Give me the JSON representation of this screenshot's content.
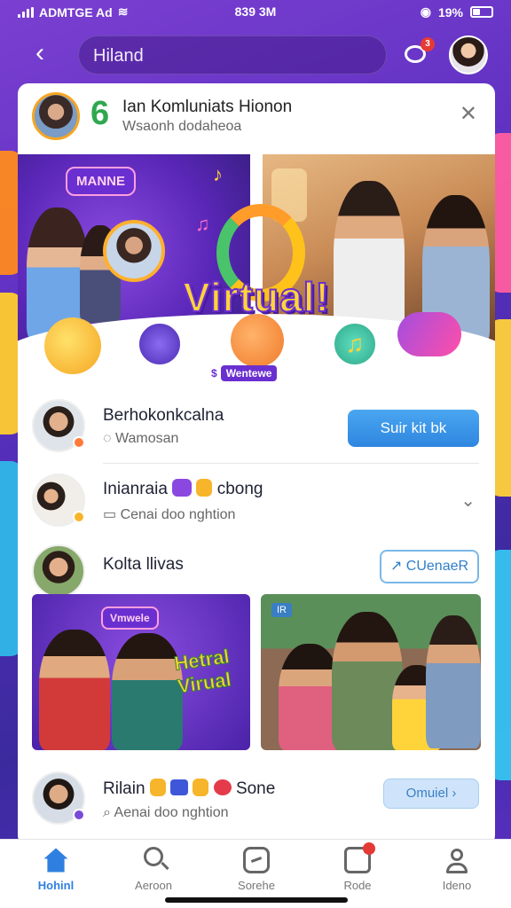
{
  "status_bar": {
    "carrier": "ADMTGE Ad",
    "time": "839 3M",
    "battery": "19%",
    "icons": [
      "signal-icon",
      "wifi-icon",
      "location-icon",
      "battery-icon"
    ]
  },
  "header": {
    "search_value": "Hiland",
    "notification_count": "3",
    "icons": [
      "back-icon",
      "chat-bubble-icon",
      "profile-avatar"
    ]
  },
  "group": {
    "title": "Ian Komluniats Hionon",
    "subtitle": "Wsaonh dodaheoa",
    "logo_glyph": "6"
  },
  "hero": {
    "speech_badge": "MANNE",
    "title": "Virtual!",
    "tag_text": "$",
    "tag_pill": "Wentewe"
  },
  "rows": [
    {
      "name": "Berhokonkcalna",
      "sub": "Wamosan",
      "button": "Suir kit bk"
    },
    {
      "name": "Inianraia",
      "name_suffix": "cbong",
      "sub": "Cenai doo nghtion"
    },
    {
      "name": "Kolta llivas",
      "button": "CUenaeR"
    },
    {
      "name": "Rilain",
      "name_suffix": "Sone",
      "sub": "Aenai doo nghtion",
      "button": "Omuiel"
    }
  ],
  "thumbs": {
    "left_badge": "Vmwele",
    "left_title": "Hetral Virual",
    "right_tag": "IR"
  },
  "bottom_nav": [
    {
      "label": "Hohinl",
      "icon": "home-icon",
      "active": true
    },
    {
      "label": "Aeroon",
      "icon": "search-icon",
      "active": false
    },
    {
      "label": "Sorehe",
      "icon": "chat-square-icon",
      "active": false
    },
    {
      "label": "Rode",
      "icon": "inbox-icon",
      "active": false
    },
    {
      "label": "Ideno",
      "icon": "person-icon",
      "active": false
    }
  ],
  "colors": {
    "accent": "#2f7fe0",
    "background_purple": "#5a2fbf",
    "notification_red": "#e53935",
    "hero_yellow": "#ffd43a"
  }
}
